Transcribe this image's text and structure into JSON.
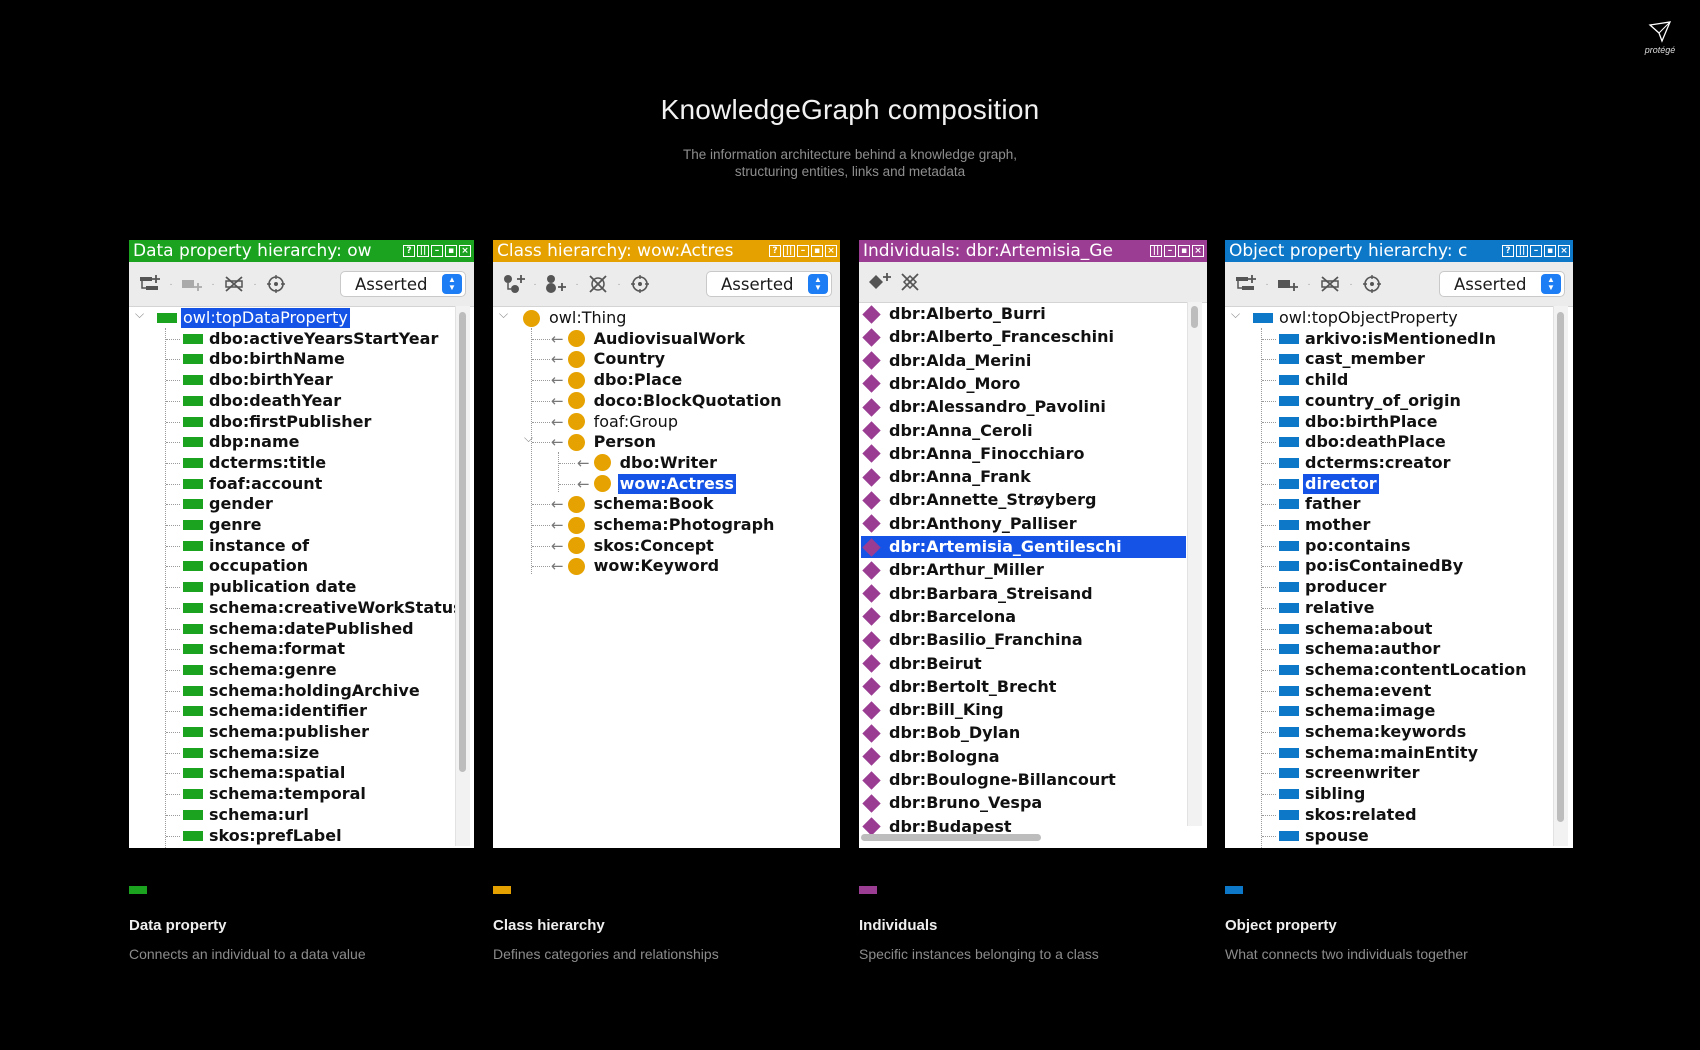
{
  "brand": {
    "name": "protégé"
  },
  "header": {
    "title": "KnowledgeGraph composition",
    "subtitle_lines": [
      "The information architecture behind a knowledge graph,",
      "structuring entities, links and metadata"
    ]
  },
  "colors": {
    "data": "#1ba320",
    "class": "#e5a100",
    "individuals": "#9b3d92",
    "object": "#0d77c8",
    "selection": "#1453e6"
  },
  "panels": {
    "data": {
      "title": "Data property hierarchy: ow",
      "asserted": "Asserted",
      "root": "owl:topDataProperty",
      "items": [
        "dbo:activeYearsStartYear",
        "dbo:birthName",
        "dbo:birthYear",
        "dbo:deathYear",
        "dbo:firstPublisher",
        "dbp:name",
        "dcterms:title",
        "foaf:account",
        "gender",
        "genre",
        "instance of",
        "occupation",
        "publication date",
        "schema:creativeWorkStatus",
        "schema:datePublished",
        "schema:format",
        "schema:genre",
        "schema:holdingArchive",
        "schema:identifier",
        "schema:publisher",
        "schema:size",
        "schema:spatial",
        "schema:temporal",
        "schema:url",
        "skos:prefLabel"
      ]
    },
    "class": {
      "title": "Class hierarchy: wow:Actres",
      "asserted": "Asserted",
      "root": "owl:Thing",
      "items": [
        "AudiovisualWork",
        "Country",
        "dbo:Place",
        "doco:BlockQuotation",
        "foaf:Group",
        "Person"
      ],
      "person_children": [
        "dbo:Writer",
        "wow:Actress"
      ],
      "items_after": [
        "schema:Book",
        "schema:Photograph",
        "skos:Concept",
        "wow:Keyword"
      ]
    },
    "individuals": {
      "title": "Individuals: dbr:Artemisia_Ge",
      "items": [
        "dbr:Alberto_Burri",
        "dbr:Alberto_Franceschini",
        "dbr:Alda_Merini",
        "dbr:Aldo_Moro",
        "dbr:Alessandro_Pavolini",
        "dbr:Anna_Ceroli",
        "dbr:Anna_Finocchiaro",
        "dbr:Anna_Frank",
        "dbr:Annette_Strøyberg",
        "dbr:Anthony_Palliser",
        "dbr:Artemisia_Gentileschi",
        "dbr:Arthur_Miller",
        "dbr:Barbara_Streisand",
        "dbr:Barcelona",
        "dbr:Basilio_Franchina",
        "dbr:Beirut",
        "dbr:Bertolt_Brecht",
        "dbr:Bill_King",
        "dbr:Bob_Dylan",
        "dbr:Bologna",
        "dbr:Boulogne-Billancourt",
        "dbr:Bruno_Vespa",
        "dbr:Budapest"
      ]
    },
    "object": {
      "title": "Object property hierarchy: c",
      "asserted": "Asserted",
      "root": "owl:topObjectProperty",
      "items": [
        "arkivo:isMentionedIn",
        "cast_member",
        "child",
        "country_of_origin",
        "dbo:birthPlace",
        "dbo:deathPlace",
        "dcterms:creator",
        "director",
        "father",
        "mother",
        "po:contains",
        "po:isContainedBy",
        "producer",
        "relative",
        "schema:about",
        "schema:author",
        "schema:contentLocation",
        "schema:event",
        "schema:image",
        "schema:keywords",
        "schema:mainEntity",
        "screenwriter",
        "sibling",
        "skos:related",
        "spouse"
      ]
    }
  },
  "legend": [
    {
      "heading": "Data property",
      "desc": "Connects an individual to a data value"
    },
    {
      "heading": "Class hierarchy",
      "desc": "Defines categories and relationships"
    },
    {
      "heading": "Individuals",
      "desc": "Specific instances belonging to a class"
    },
    {
      "heading": "Object property",
      "desc": "What connects two individuals together"
    }
  ]
}
